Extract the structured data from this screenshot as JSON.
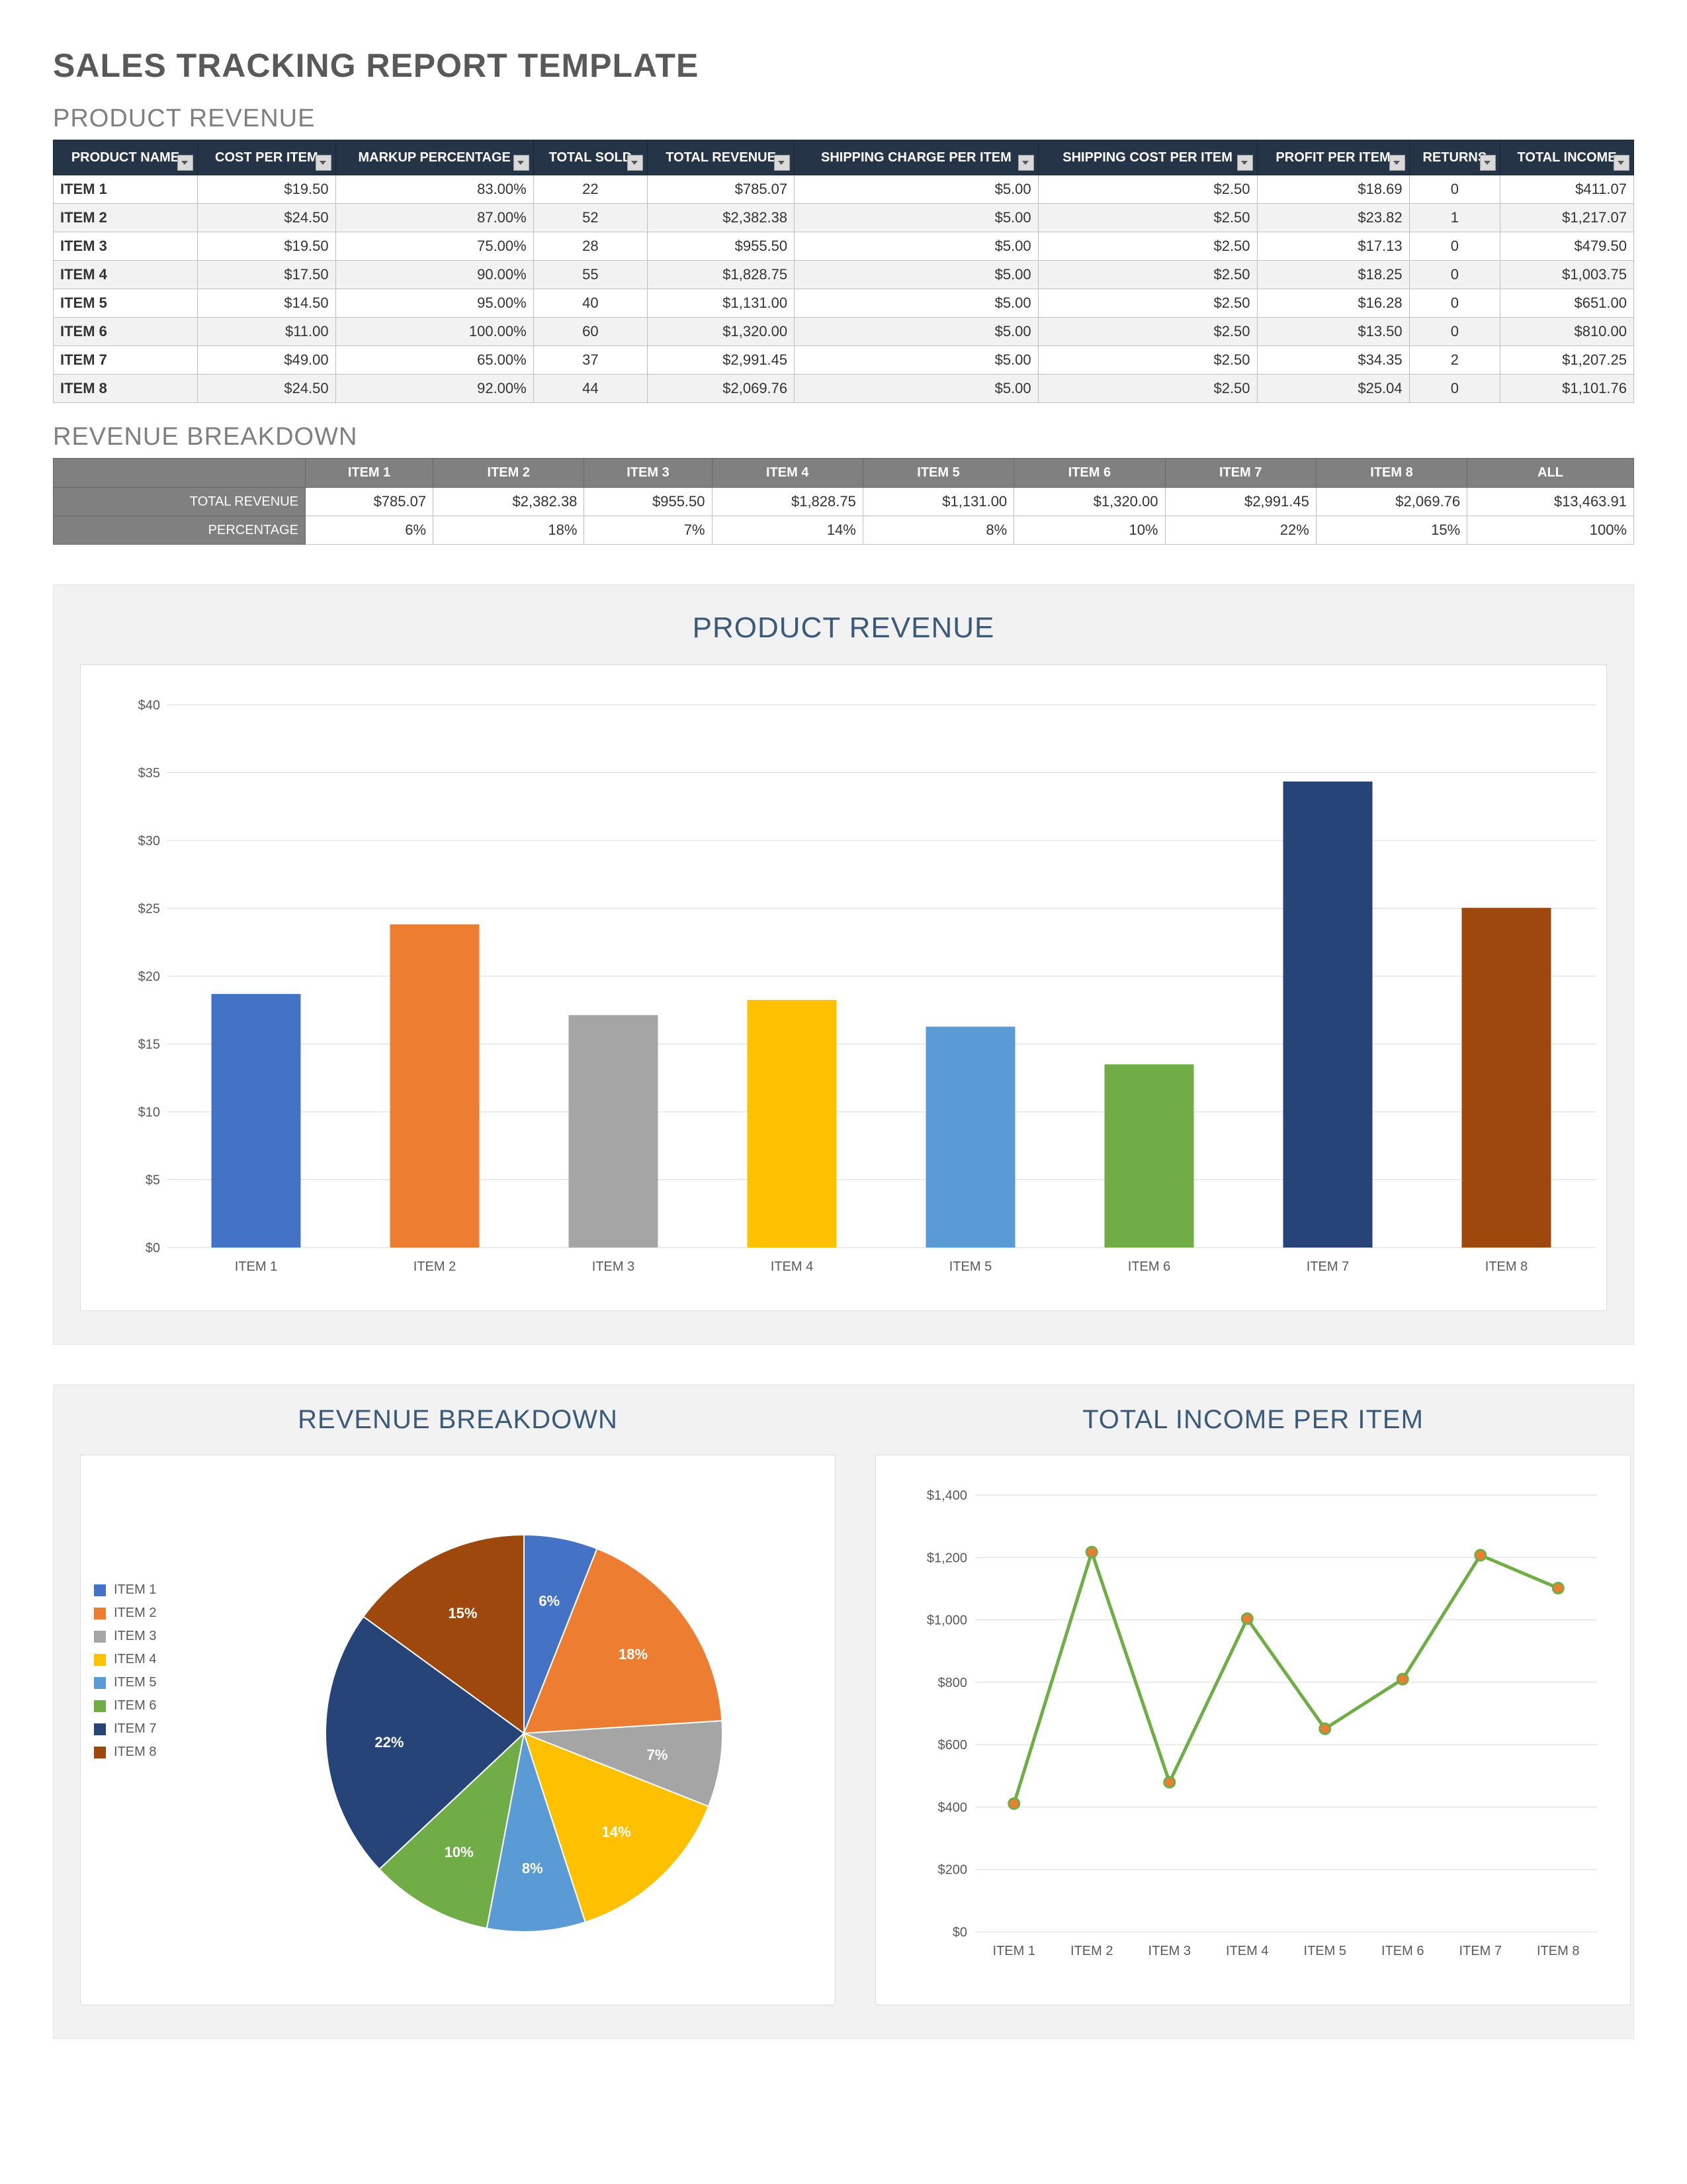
{
  "title": "SALES TRACKING REPORT TEMPLATE",
  "sections": {
    "product_revenue_title": "PRODUCT REVENUE",
    "revenue_breakdown_title": "REVENUE BREAKDOWN",
    "bar_chart_title": "PRODUCT REVENUE",
    "pie_chart_title": "REVENUE BREAKDOWN",
    "line_chart_title": "TOTAL INCOME PER ITEM"
  },
  "pr_headers": [
    "PRODUCT NAME",
    "COST PER ITEM",
    "MARKUP PERCENTAGE",
    "TOTAL SOLD",
    "TOTAL REVENUE",
    "SHIPPING CHARGE PER ITEM",
    "SHIPPING COST PER ITEM",
    "PROFIT PER ITEM",
    "RETURNS",
    "TOTAL INCOME"
  ],
  "pr_rows": [
    {
      "name": "ITEM 1",
      "cost": "$19.50",
      "markup": "83.00%",
      "sold": "22",
      "revenue": "$785.07",
      "ship_charge": "$5.00",
      "ship_cost": "$2.50",
      "profit": "$18.69",
      "returns": "0",
      "income": "$411.07"
    },
    {
      "name": "ITEM 2",
      "cost": "$24.50",
      "markup": "87.00%",
      "sold": "52",
      "revenue": "$2,382.38",
      "ship_charge": "$5.00",
      "ship_cost": "$2.50",
      "profit": "$23.82",
      "returns": "1",
      "income": "$1,217.07"
    },
    {
      "name": "ITEM 3",
      "cost": "$19.50",
      "markup": "75.00%",
      "sold": "28",
      "revenue": "$955.50",
      "ship_charge": "$5.00",
      "ship_cost": "$2.50",
      "profit": "$17.13",
      "returns": "0",
      "income": "$479.50"
    },
    {
      "name": "ITEM 4",
      "cost": "$17.50",
      "markup": "90.00%",
      "sold": "55",
      "revenue": "$1,828.75",
      "ship_charge": "$5.00",
      "ship_cost": "$2.50",
      "profit": "$18.25",
      "returns": "0",
      "income": "$1,003.75"
    },
    {
      "name": "ITEM 5",
      "cost": "$14.50",
      "markup": "95.00%",
      "sold": "40",
      "revenue": "$1,131.00",
      "ship_charge": "$5.00",
      "ship_cost": "$2.50",
      "profit": "$16.28",
      "returns": "0",
      "income": "$651.00"
    },
    {
      "name": "ITEM 6",
      "cost": "$11.00",
      "markup": "100.00%",
      "sold": "60",
      "revenue": "$1,320.00",
      "ship_charge": "$5.00",
      "ship_cost": "$2.50",
      "profit": "$13.50",
      "returns": "0",
      "income": "$810.00"
    },
    {
      "name": "ITEM 7",
      "cost": "$49.00",
      "markup": "65.00%",
      "sold": "37",
      "revenue": "$2,991.45",
      "ship_charge": "$5.00",
      "ship_cost": "$2.50",
      "profit": "$34.35",
      "returns": "2",
      "income": "$1,207.25"
    },
    {
      "name": "ITEM 8",
      "cost": "$24.50",
      "markup": "92.00%",
      "sold": "44",
      "revenue": "$2,069.76",
      "ship_charge": "$5.00",
      "ship_cost": "$2.50",
      "profit": "$25.04",
      "returns": "0",
      "income": "$1,101.76"
    }
  ],
  "rb_col_headers": [
    "ITEM 1",
    "ITEM 2",
    "ITEM 3",
    "ITEM 4",
    "ITEM 5",
    "ITEM 6",
    "ITEM 7",
    "ITEM 8",
    "ALL"
  ],
  "rb_rows": [
    {
      "label": "TOTAL REVENUE",
      "cells": [
        "$785.07",
        "$2,382.38",
        "$955.50",
        "$1,828.75",
        "$1,131.00",
        "$1,320.00",
        "$2,991.45",
        "$2,069.76",
        "$13,463.91"
      ]
    },
    {
      "label": "PERCENTAGE",
      "cells": [
        "6%",
        "18%",
        "7%",
        "14%",
        "8%",
        "10%",
        "22%",
        "15%",
        "100%"
      ]
    }
  ],
  "colors": {
    "series": [
      "#4472c4",
      "#ed7d31",
      "#a5a5a5",
      "#ffc000",
      "#5b9bd5",
      "#70ad47",
      "#264478",
      "#9e480e"
    ]
  },
  "chart_data": [
    {
      "id": "bar",
      "type": "bar",
      "title": "PRODUCT REVENUE",
      "categories": [
        "ITEM 1",
        "ITEM 2",
        "ITEM 3",
        "ITEM 4",
        "ITEM 5",
        "ITEM 6",
        "ITEM 7",
        "ITEM 8"
      ],
      "values": [
        18.69,
        23.82,
        17.13,
        18.25,
        16.28,
        13.5,
        34.35,
        25.04
      ],
      "ylabel": "",
      "xlabel": "",
      "ylim": [
        0,
        40
      ],
      "ytick": 5,
      "yformat": "$"
    },
    {
      "id": "pie",
      "type": "pie",
      "title": "REVENUE BREAKDOWN",
      "categories": [
        "ITEM 1",
        "ITEM 2",
        "ITEM 3",
        "ITEM 4",
        "ITEM 5",
        "ITEM 6",
        "ITEM 7",
        "ITEM 8"
      ],
      "values": [
        6,
        18,
        7,
        14,
        8,
        10,
        22,
        15
      ],
      "value_suffix": "%"
    },
    {
      "id": "line",
      "type": "line",
      "title": "TOTAL INCOME PER ITEM",
      "categories": [
        "ITEM 1",
        "ITEM 2",
        "ITEM 3",
        "ITEM 4",
        "ITEM 5",
        "ITEM 6",
        "ITEM 7",
        "ITEM 8"
      ],
      "values": [
        411.07,
        1217.07,
        479.5,
        1003.75,
        651.0,
        810.0,
        1207.25,
        1101.76
      ],
      "ylim": [
        0,
        1400
      ],
      "ytick": 200,
      "yformat": "$",
      "line_color": "#70ad47",
      "marker_color": "#ed7d31"
    }
  ]
}
